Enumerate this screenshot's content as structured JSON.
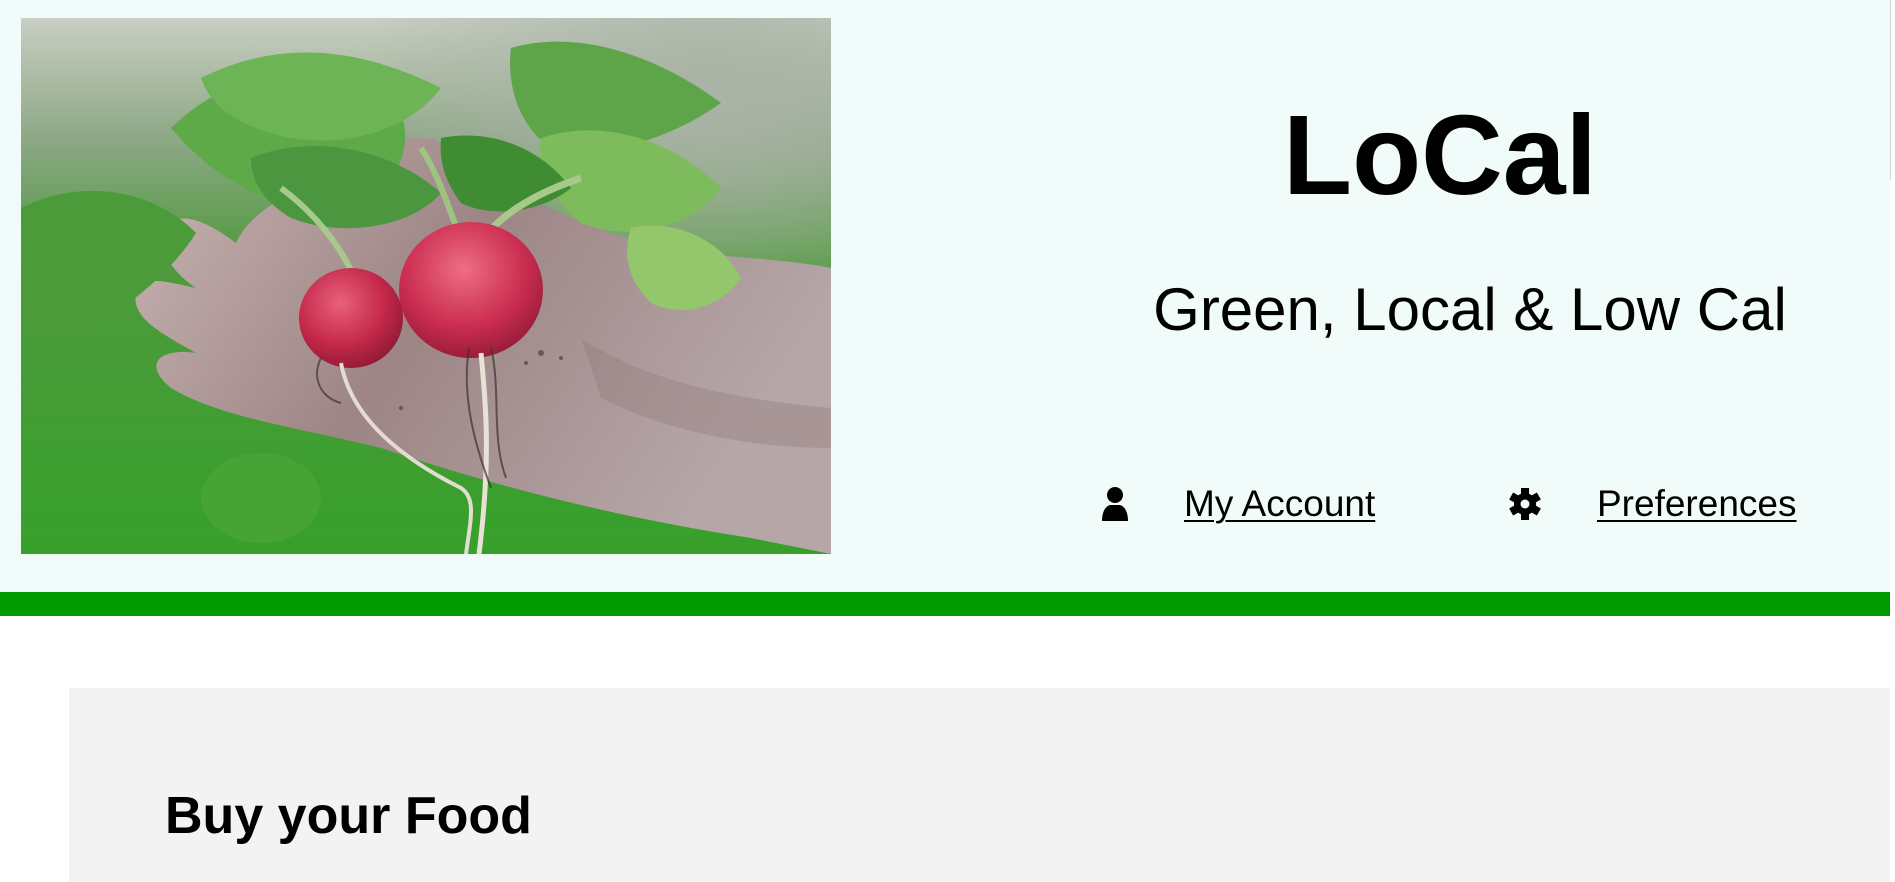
{
  "header": {
    "brand": "LoCal",
    "tagline": "Green, Local & Low Cal",
    "hero_image": {
      "subject": "radishes"
    },
    "nav": {
      "account": {
        "label": "My Account",
        "icon": "user-icon"
      },
      "preferences": {
        "label": "Preferences",
        "icon": "gear-icon"
      }
    }
  },
  "main": {
    "section_title": "Buy your Food"
  },
  "colors": {
    "header_bg": "#f0fbfa",
    "accent_bar": "#009900",
    "section_bg": "#f3f3f3"
  }
}
